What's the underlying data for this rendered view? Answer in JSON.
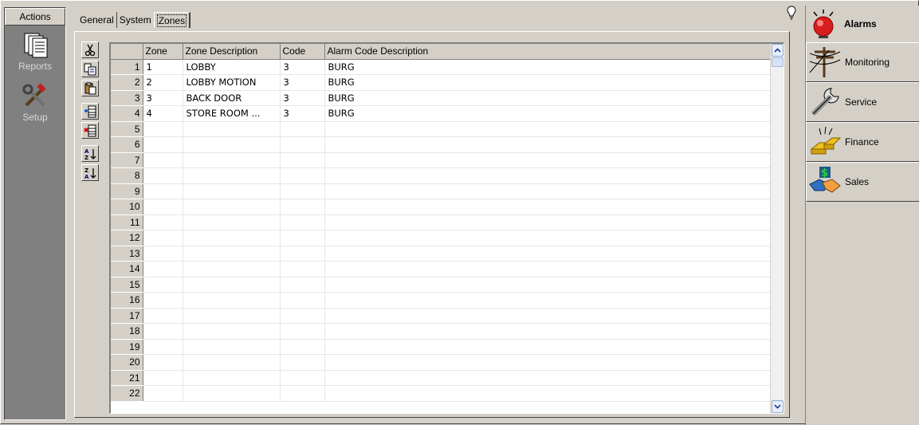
{
  "actions": {
    "header": "Actions",
    "items": [
      {
        "label": "Reports",
        "icon": "reports-icon"
      },
      {
        "label": "Setup",
        "icon": "setup-icon"
      }
    ]
  },
  "tabs": [
    {
      "label": "General",
      "active": false
    },
    {
      "label": "System",
      "active": false
    },
    {
      "label": "Zones",
      "active": true
    }
  ],
  "toolbar": {
    "icons": [
      "cut-icon",
      "copy-icon",
      "paste-icon",
      "insert-row-icon",
      "delete-row-icon",
      "sort-ascending-icon",
      "sort-descending-icon"
    ]
  },
  "grid": {
    "columns": [
      "Zone",
      "Zone Description",
      "Code",
      "Alarm Code Description"
    ],
    "rows": [
      {
        "n": "1",
        "zone": "1",
        "desc": "LOBBY",
        "code": "3",
        "alarm": "BURG"
      },
      {
        "n": "2",
        "zone": "2",
        "desc": "LOBBY MOTION",
        "code": "3",
        "alarm": "BURG"
      },
      {
        "n": "3",
        "zone": "3",
        "desc": "BACK DOOR",
        "code": "3",
        "alarm": "BURG"
      },
      {
        "n": "4",
        "zone": "4",
        "desc": "STORE ROOM ...",
        "code": "3",
        "alarm": "BURG"
      },
      {
        "n": "5",
        "zone": "",
        "desc": "",
        "code": "",
        "alarm": ""
      },
      {
        "n": "6",
        "zone": "",
        "desc": "",
        "code": "",
        "alarm": ""
      },
      {
        "n": "7",
        "zone": "",
        "desc": "",
        "code": "",
        "alarm": ""
      },
      {
        "n": "8",
        "zone": "",
        "desc": "",
        "code": "",
        "alarm": ""
      },
      {
        "n": "9",
        "zone": "",
        "desc": "",
        "code": "",
        "alarm": ""
      },
      {
        "n": "10",
        "zone": "",
        "desc": "",
        "code": "",
        "alarm": ""
      },
      {
        "n": "11",
        "zone": "",
        "desc": "",
        "code": "",
        "alarm": ""
      },
      {
        "n": "12",
        "zone": "",
        "desc": "",
        "code": "",
        "alarm": ""
      },
      {
        "n": "13",
        "zone": "",
        "desc": "",
        "code": "",
        "alarm": ""
      },
      {
        "n": "14",
        "zone": "",
        "desc": "",
        "code": "",
        "alarm": ""
      },
      {
        "n": "15",
        "zone": "",
        "desc": "",
        "code": "",
        "alarm": ""
      },
      {
        "n": "16",
        "zone": "",
        "desc": "",
        "code": "",
        "alarm": ""
      },
      {
        "n": "17",
        "zone": "",
        "desc": "",
        "code": "",
        "alarm": ""
      },
      {
        "n": "18",
        "zone": "",
        "desc": "",
        "code": "",
        "alarm": ""
      },
      {
        "n": "19",
        "zone": "",
        "desc": "",
        "code": "",
        "alarm": ""
      },
      {
        "n": "20",
        "zone": "",
        "desc": "",
        "code": "",
        "alarm": ""
      },
      {
        "n": "21",
        "zone": "",
        "desc": "",
        "code": "",
        "alarm": ""
      },
      {
        "n": "22",
        "zone": "",
        "desc": "",
        "code": "",
        "alarm": ""
      }
    ]
  },
  "nav": {
    "items": [
      {
        "label": "Alarms",
        "icon": "alarm-bell-icon",
        "active": true
      },
      {
        "label": "Monitoring",
        "icon": "telephone-pole-icon",
        "active": false
      },
      {
        "label": "Service",
        "icon": "wrench-icon",
        "active": false
      },
      {
        "label": "Finance",
        "icon": "gold-bars-icon",
        "active": false
      },
      {
        "label": "Sales",
        "icon": "handshake-money-icon",
        "active": false
      }
    ]
  },
  "colors": {
    "face": "#d4d0c8",
    "actionbar": "#808080",
    "alarm_red": "#d81e1e"
  }
}
